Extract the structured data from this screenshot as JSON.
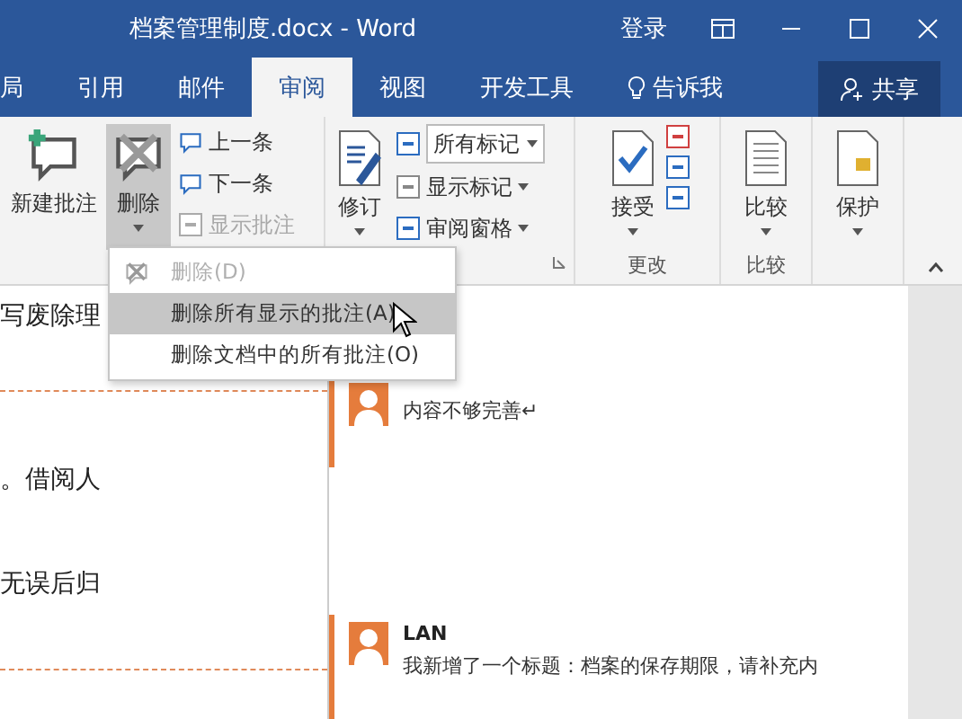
{
  "window": {
    "title": "档案管理制度.docx - Word",
    "sign_in": "登录"
  },
  "tabs": [
    {
      "label": "局",
      "selected": false
    },
    {
      "label": "引用",
      "selected": false
    },
    {
      "label": "邮件",
      "selected": false
    },
    {
      "label": "审阅",
      "selected": true
    },
    {
      "label": "视图",
      "selected": false
    },
    {
      "label": "开发工具",
      "selected": false
    }
  ],
  "tell_me": "告诉我",
  "share": "共享",
  "comments_group": {
    "new_comment": "新建批注",
    "delete": {
      "label": "删除",
      "pressed": true
    },
    "previous": "上一条",
    "next": "下一条",
    "show_comments": {
      "label": "显示批注",
      "disabled": true
    }
  },
  "tracking_group": {
    "track_changes": "修订",
    "markup_select": "所有标记",
    "show_markup": "显示标记",
    "reviewing_pane": "审阅窗格"
  },
  "changes_group": {
    "accept": "接受",
    "label": "更改"
  },
  "compare_group": {
    "compare": "比较",
    "label": "比较"
  },
  "protect_group": {
    "protect": "保护"
  },
  "delete_menu": [
    {
      "label": "删除(D)",
      "disabled": true,
      "selected": false
    },
    {
      "label": "删除所有显示的批注(A)",
      "disabled": false,
      "selected": true
    },
    {
      "label": "删除文档中的所有批注(O)",
      "disabled": false,
      "selected": false
    }
  ],
  "document": {
    "lines": [
      "写废除理",
      "。借阅人",
      "无误后归"
    ]
  },
  "comments": [
    {
      "text": "内容不够完善↵"
    },
    {
      "author": "LAN",
      "text": "我新增了一个标题：档案的保存期限，请补充内"
    }
  ]
}
